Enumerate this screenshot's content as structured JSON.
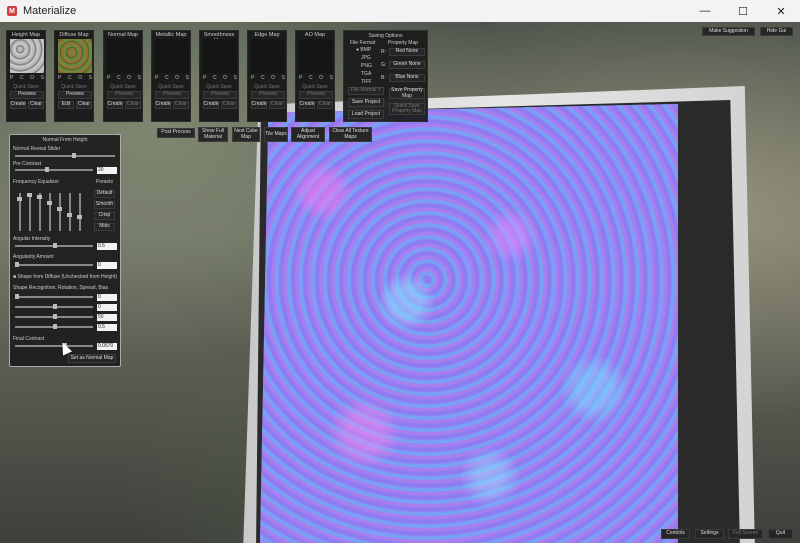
{
  "window": {
    "title": "Materialize",
    "minimize": "—",
    "maximize": "☐",
    "close": "✕"
  },
  "top_right": {
    "make_suggestion": "Make Suggestion",
    "hide_gui": "Hide Gui"
  },
  "maps": [
    {
      "title": "Height Map",
      "p": "P",
      "c": "C",
      "o": "O",
      "s": "S",
      "quick_save": "Quick Save",
      "preview": "Preview",
      "btn1": "Create",
      "btn2": "Clear"
    },
    {
      "title": "Diffuse Map",
      "p": "P",
      "c": "C",
      "o": "O",
      "s": "S",
      "quick_save": "Quick Save",
      "preview": "Preview",
      "btn1": "Edit",
      "btn2": "Clear"
    },
    {
      "title": "Normal Map",
      "p": "P",
      "c": "C",
      "o": "O",
      "s": "S",
      "quick_save": "Quick Save",
      "preview": "Preview",
      "btn1": "Create",
      "btn2": "Clear"
    },
    {
      "title": "Metallic Map",
      "p": "P",
      "c": "C",
      "o": "O",
      "s": "S",
      "quick_save": "Quick Save",
      "preview": "Preview",
      "btn1": "Create",
      "btn2": "Clear"
    },
    {
      "title": "Smoothness Map",
      "p": "P",
      "c": "C",
      "o": "O",
      "s": "S",
      "quick_save": "Quick Save",
      "preview": "Preview",
      "btn1": "Create",
      "btn2": "Clear"
    },
    {
      "title": "Edge Map",
      "p": "P",
      "c": "C",
      "o": "O",
      "s": "S",
      "quick_save": "Quick Save",
      "preview": "Preview",
      "btn1": "Create",
      "btn2": "Clear"
    },
    {
      "title": "AO Map",
      "p": "P",
      "c": "C",
      "o": "O",
      "s": "S",
      "quick_save": "Quick Save",
      "preview": "Preview",
      "btn1": "Create",
      "btn2": "Clear"
    }
  ],
  "saving": {
    "title": "Saving Options",
    "file_format": "File Format",
    "formats": [
      "BMP",
      "JPG",
      "PNG",
      "TGA",
      "TIFF"
    ],
    "property_map": "Property Map",
    "r": "R:",
    "g": "G:",
    "b": "B:",
    "red": "Red None",
    "green": "Green None",
    "blue": "Blue None",
    "file_normal": "File Normal Y",
    "save_property_map": "Save Property Map",
    "save_project": "Save Project",
    "quick_save_property": "Quick Save Property Map",
    "load_project": "Load Project"
  },
  "toolbar": {
    "post_process": "Post Process",
    "show_full_material": "Show Full Material",
    "next_cube_map": "Next Cube Map",
    "tile_maps": "Tile Maps",
    "adjust_alignment": "Adjust Alignment",
    "clear_all": "Clear All Texture Maps"
  },
  "panel": {
    "title": "Normal From Height",
    "reveal_slider": "Normal Reveal Slider",
    "pre_contrast": "Pre Contrast",
    "pre_contrast_value": "20",
    "freq_eq": "Frequency Equalizer",
    "presets": "Presets",
    "preset_default": "Default",
    "preset_smooth": "Smooth",
    "preset_crisp": "Crisp",
    "preset_mids": "Mids",
    "angular_intensity": "Angular Intensity",
    "angular_intensity_value": "0.5",
    "angularity_amount": "Angularity Amount",
    "angularity_amount_value": "0",
    "shape_checkbox": "Shape from Diffuse (Unchecked from Height)",
    "shape_recognition": "Shape Recognition, Rotation, Spread, Bias",
    "shape_values": [
      "0",
      "0",
      "50",
      "0.5"
    ],
    "final_contrast": "Final Contrast",
    "final_contrast_value": "0.0570",
    "set_normal": "Set as Normal Map"
  },
  "bottom": {
    "controls": "Controls",
    "settings": "Settings",
    "full_screen": "Full Screen",
    "quit": "Quit"
  }
}
